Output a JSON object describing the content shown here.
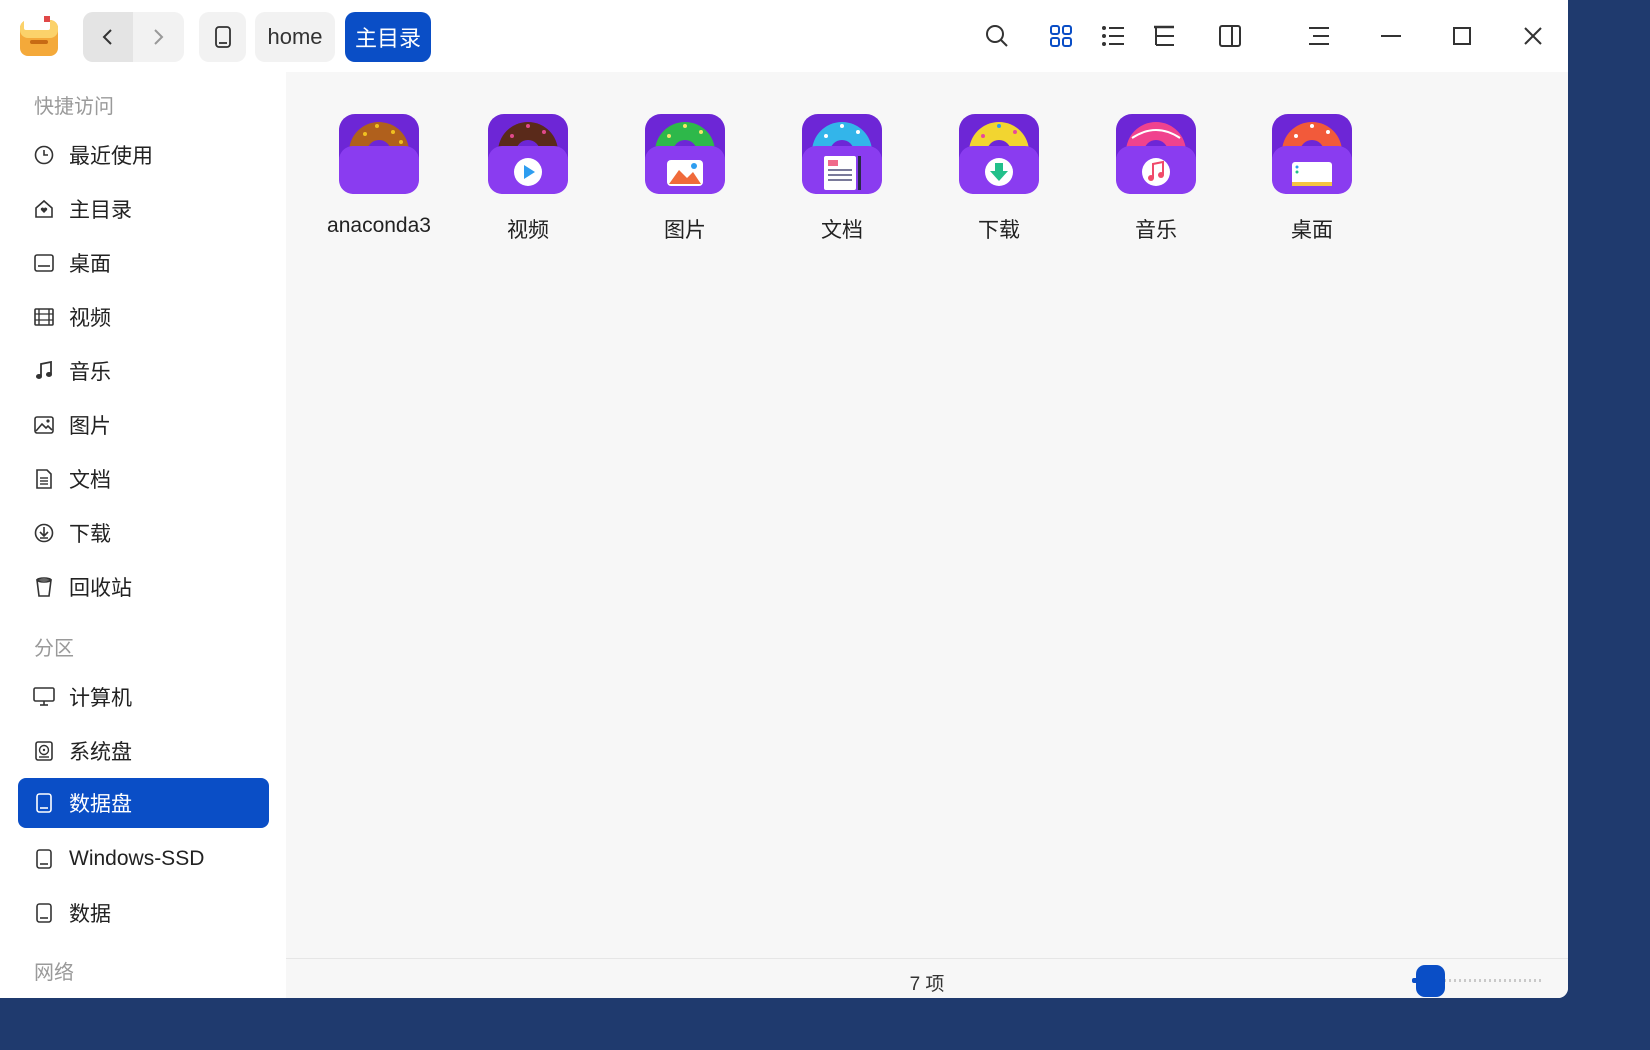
{
  "titlebar": {
    "breadcrumb": {
      "home": "home",
      "current": "主目录"
    }
  },
  "sidebar": {
    "sections": {
      "quick_access": "快捷访问",
      "partitions": "分区",
      "network": "网络"
    },
    "quick_items": [
      {
        "label": "最近使用",
        "icon": "clock-icon"
      },
      {
        "label": "主目录",
        "icon": "home-icon"
      },
      {
        "label": "桌面",
        "icon": "desktop-icon"
      },
      {
        "label": "视频",
        "icon": "film-icon"
      },
      {
        "label": "音乐",
        "icon": "music-note-icon"
      },
      {
        "label": "图片",
        "icon": "image-icon"
      },
      {
        "label": "文档",
        "icon": "document-icon"
      },
      {
        "label": "下载",
        "icon": "download-icon"
      },
      {
        "label": "回收站",
        "icon": "trash-icon"
      }
    ],
    "partition_items": [
      {
        "label": "计算机",
        "icon": "monitor-icon"
      },
      {
        "label": "系统盘",
        "icon": "system-disk-icon"
      },
      {
        "label": "数据盘",
        "icon": "disk-icon",
        "active": true
      },
      {
        "label": "Windows-SSD",
        "icon": "disk-icon"
      },
      {
        "label": "数据",
        "icon": "disk-icon"
      }
    ]
  },
  "files": [
    {
      "name": "anaconda3",
      "donut": "#b0601c",
      "sprinkle": "#f0c020",
      "badge": "none"
    },
    {
      "name": "视频",
      "donut": "#5a2a1a",
      "sprinkle": "#e04a8a",
      "badge": "play"
    },
    {
      "name": "图片",
      "donut": "#2eb84a",
      "sprinkle": "#f5e66a",
      "badge": "picture"
    },
    {
      "name": "文档",
      "donut": "#33b5ea",
      "sprinkle": "#ffffff",
      "badge": "doc"
    },
    {
      "name": "下载",
      "donut": "#f2d530",
      "sprinkle": "#e84a9a",
      "badge": "download"
    },
    {
      "name": "音乐",
      "donut": "#f0428e",
      "sprinkle": "#ffffff",
      "badge": "music"
    },
    {
      "name": "桌面",
      "donut": "#f25a3a",
      "sprinkle": "#ffffff",
      "badge": "desktop"
    }
  ],
  "status": {
    "count_text": "7 项",
    "zoom_level": 0.05
  },
  "colors": {
    "accent": "#0a4ec6",
    "folder": "#8a3cf0",
    "folder_dark": "#6d26d6"
  }
}
